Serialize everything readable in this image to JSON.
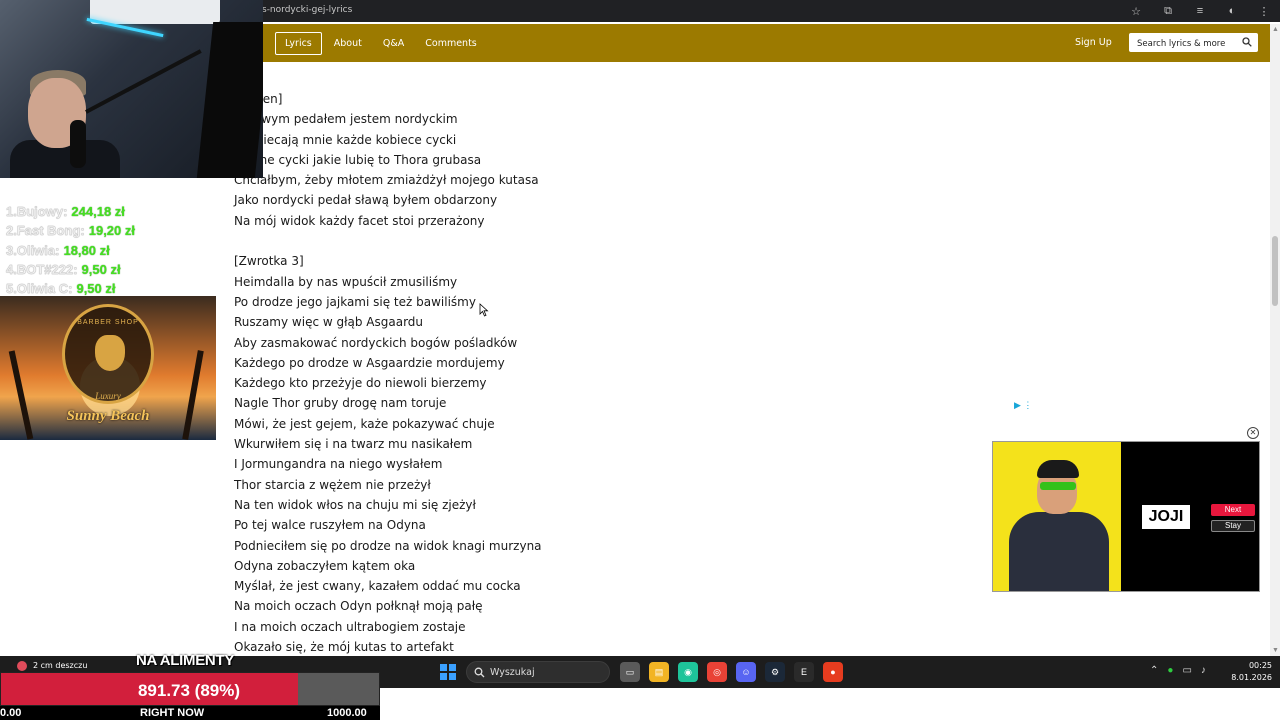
{
  "browser": {
    "url_fragment": "s-nordycki-gej-lyrics"
  },
  "nav": {
    "tabs": [
      {
        "label": "Lyrics",
        "active": true
      },
      {
        "label": "About",
        "active": false
      },
      {
        "label": "Q&A",
        "active": false
      },
      {
        "label": "Comments",
        "active": false
      }
    ],
    "signup_label": "Sign Up",
    "search_placeholder": "Search lyrics & more",
    "accent_color": "#9c7a00"
  },
  "lyrics": [
    "[Refren]",
    "Gejowym pedałem jestem nordyckim",
    "Podniecają mnie każde kobiece cycki",
    "Jedyne cycki jakie lubię to Thora grubasa",
    "Chciałbym, żeby młotem zmiażdżył mojego kutasa",
    "Jako nordycki pedał sławą byłem obdarzony",
    "Na mój widok każdy facet stoi przerażony",
    "",
    "[Zwrotka 3]",
    "Heimdalla by nas wpuścił zmusiliśmy",
    "Po drodze jego jajkami się też bawiliśmy",
    "Ruszamy więc w głąb Asgaardu",
    "Aby zasmakować nordyckich bogów pośladków",
    "Każdego po drodze w Asgaardzie mordujemy",
    "Każdego kto przeżyje do niewoli bierzemy",
    "Nagle Thor gruby drogę nam toruje",
    "Mówi, że jest gejem, każe pokazywać chuje",
    "Wkurwiłem się i na twarz mu nasikałem",
    "I Jormungandra na niego wysłałem",
    "Thor starcia z wężem nie przeżył",
    "Na ten widok włos na chuju mi się zjeżył",
    "Po tej walce ruszyłem na Odyna",
    "Podnieciłem się po drodze na widok knagi murzyna",
    "Odyna zobaczyłem kątem oka",
    "Myślał, że jest cwany, kazałem oddać mu cocka",
    "Na moich oczach Odyn połknął moją pałę",
    "I na moich oczach ultrabogiem zostaje",
    "Okazało się, że mój kutas to artefakt"
  ],
  "ad": {
    "brand": "JOJI",
    "next_label": "Next",
    "stay_label": "Stay"
  },
  "overlay": {
    "donors": [
      {
        "name": "1.Bujowy:",
        "amount": "244,18 zł"
      },
      {
        "name": "2.Fast Bong:",
        "amount": "19,20 zł"
      },
      {
        "name": "3.Oliwia:",
        "amount": "18,80 zł"
      },
      {
        "name": "4.BOT#222:",
        "amount": "9,50 zł"
      },
      {
        "name": "5.Oliwia C:",
        "amount": "9,50 zł"
      }
    ],
    "sponsor": {
      "badge_top": "BARBER SHOP",
      "badge_mid": "Luxury",
      "title": "Sunny Beach"
    },
    "goal": {
      "title": "NA ALIMENTY",
      "value_text": "891.73 (89%)",
      "progress_fraction": 0.8917,
      "min_label": "0.00",
      "now_label": "RIGHT NOW",
      "max_label": "1000.00"
    }
  },
  "taskbar": {
    "weather": "2 cm deszczu",
    "search_label": "Wyszukaj",
    "time": "00:25",
    "date": "8.01.2026"
  }
}
